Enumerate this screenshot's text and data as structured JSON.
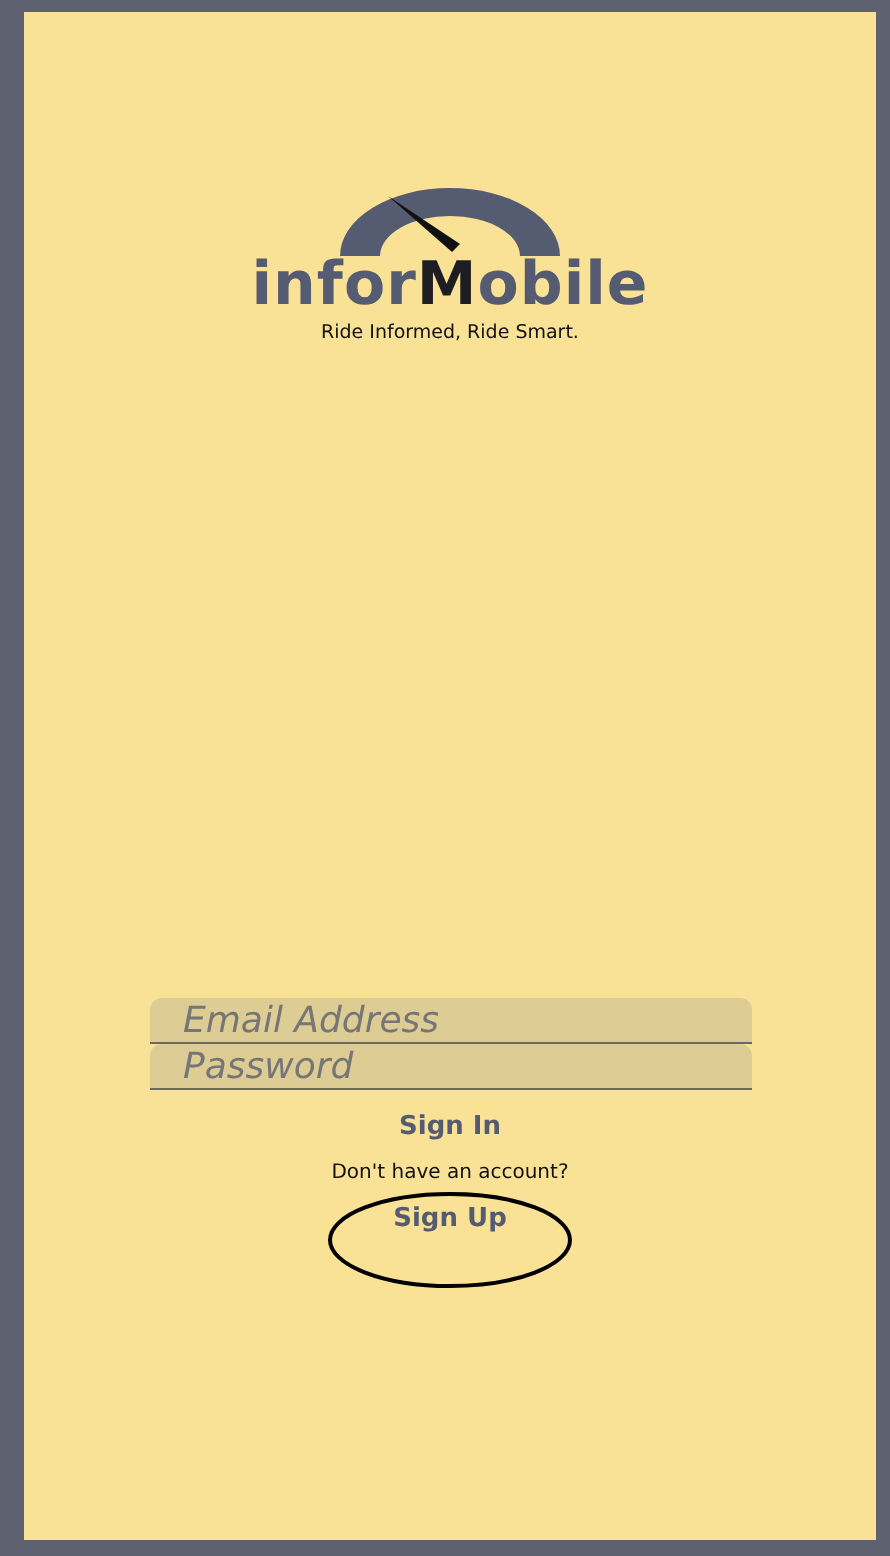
{
  "logo": {
    "wordmark": "infor**M**obile",
    "tagline": "Ride Informed, Ride Smart."
  },
  "form": {
    "email": {
      "placeholder": "Email Address"
    },
    "password": {
      "placeholder": "Password"
    },
    "sign_in": "Sign In",
    "prompt": "Don't have an account?",
    "sign_up": "Sign Up"
  }
}
